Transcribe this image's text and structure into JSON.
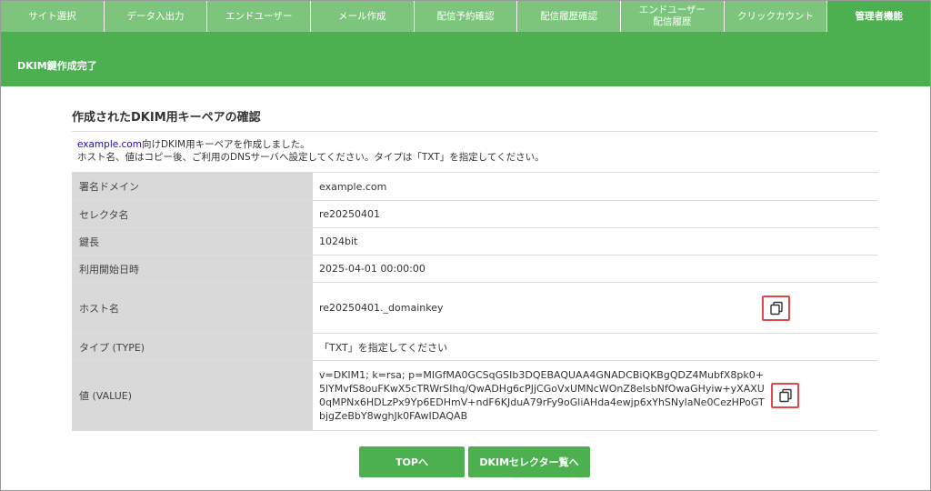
{
  "nav": {
    "tabs": [
      {
        "label": "サイト選択"
      },
      {
        "label": "データ入出力"
      },
      {
        "label": "エンドユーザー"
      },
      {
        "label": "メール作成"
      },
      {
        "label": "配信予約確認"
      },
      {
        "label": "配信履歴確認"
      },
      {
        "label": "エンドユーザー",
        "label2": "配信履歴"
      },
      {
        "label": "クリックカウント"
      },
      {
        "label": "管理者機能"
      }
    ]
  },
  "banner": {
    "text": "DKIM鍵作成完了"
  },
  "section": {
    "title": "作成されたDKIM用キーペアの確認"
  },
  "intro": {
    "domain_link": "example.com",
    "line1_rest": "向けDKIM用キーペアを作成しました。",
    "line2": "ホスト名、値はコピー後、ご利用のDNSサーバへ設定してください。タイプは「TXT」を指定してください。"
  },
  "rows": {
    "domain": {
      "label": "署名ドメイン",
      "value": "example.com"
    },
    "selector": {
      "label": "セレクタ名",
      "value": "re20250401"
    },
    "keylen": {
      "label": "鍵長",
      "value": "1024bit"
    },
    "start": {
      "label": "利用開始日時",
      "value": "2025-04-01 00:00:00"
    },
    "host": {
      "label": "ホスト名",
      "value": "re20250401._domainkey"
    },
    "type": {
      "label": "タイプ (TYPE)",
      "value": "「TXT」を指定してください"
    },
    "value": {
      "label": "値 (VALUE)",
      "value": "v=DKIM1; k=rsa; p=MIGfMA0GCSqGSIb3DQEBAQUAA4GNADCBiQKBgQDZ4MubfX8pk0+5lYMvfS8ouFKwX5cTRWrSIhq/QwADHg6cPJjCGoVxUMNcWOnZ8eIsbNfOwaGHyiw+yXAXU0qMPNx6HDLzPx9Yp6EDHmV+ndF6KJduA79rFy9oGliAHda4ewjp6xYhSNylaNe0CezHPoGTbjgZeBbY8wghJk0FAwIDAQAB"
    }
  },
  "icons": {
    "copy": "copy-icon"
  },
  "buttons": {
    "top": "TOPへ",
    "selector_list": "DKIMセレクター覧へ"
  },
  "colors": {
    "primary": "#4caf50",
    "tab_bg": "#7dc57d",
    "highlight": "#e24848",
    "label_bg": "#d9d9d9"
  }
}
